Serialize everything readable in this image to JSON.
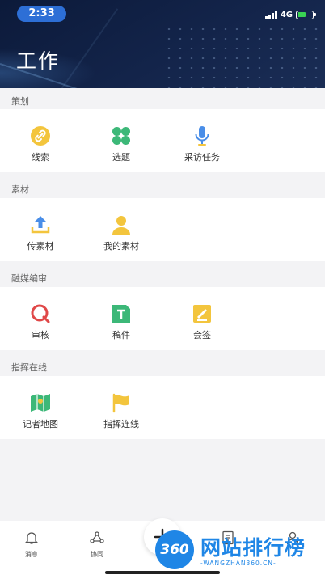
{
  "status_bar": {
    "time": "2:33",
    "network": "4G"
  },
  "header": {
    "title": "工作"
  },
  "sections": [
    {
      "label": "策划",
      "items": [
        {
          "label": "线索",
          "icon": "link-icon"
        },
        {
          "label": "选题",
          "icon": "grid-icon"
        },
        {
          "label": "采访任务",
          "icon": "microphone-icon"
        }
      ]
    },
    {
      "label": "素材",
      "items": [
        {
          "label": "传素材",
          "icon": "upload-icon"
        },
        {
          "label": "我的素材",
          "icon": "user-icon"
        }
      ]
    },
    {
      "label": "融媒编审",
      "items": [
        {
          "label": "审核",
          "icon": "review-icon"
        },
        {
          "label": "稿件",
          "icon": "document-icon"
        },
        {
          "label": "会签",
          "icon": "sign-icon"
        }
      ]
    },
    {
      "label": "指挥在线",
      "items": [
        {
          "label": "记者地图",
          "icon": "map-icon"
        },
        {
          "label": "指挥连线",
          "icon": "flag-icon"
        }
      ]
    }
  ],
  "tabbar": {
    "tabs": [
      {
        "label": "消息",
        "icon": "bell-icon"
      },
      {
        "label": "协同",
        "icon": "network-icon"
      }
    ]
  },
  "watermark": {
    "logo": "360",
    "text": "网站排行榜",
    "sub": "-WANGZHAN360.CN-"
  },
  "colors": {
    "header_bg": "#13244a",
    "accent_blue": "#2d6fd6",
    "icon_yellow": "#f3c53d",
    "icon_green": "#3cb878",
    "icon_blue": "#4a8ee8",
    "icon_red": "#e04848"
  }
}
